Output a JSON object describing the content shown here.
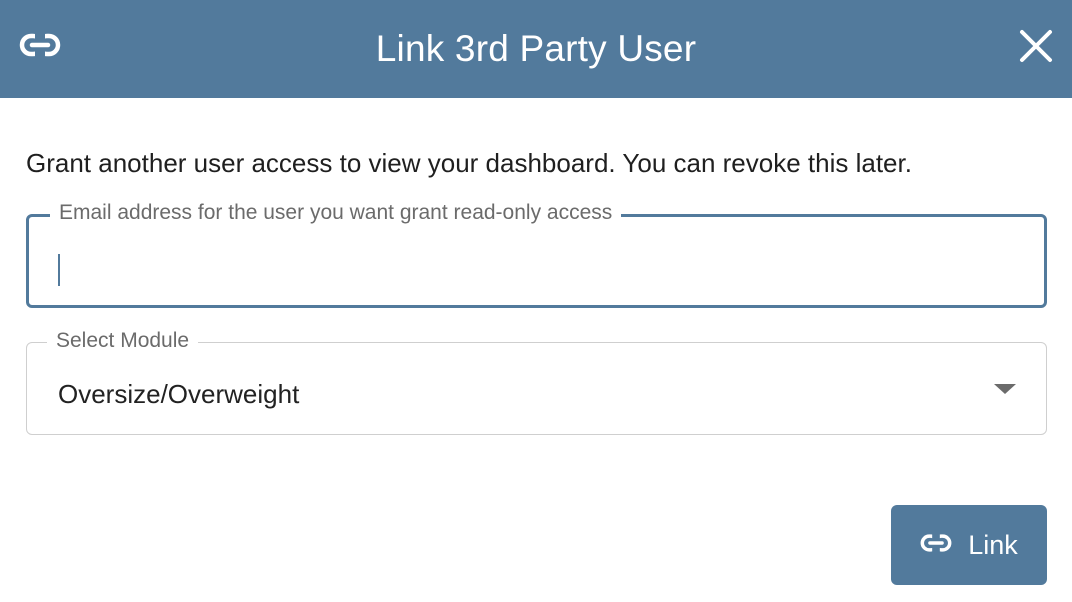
{
  "header": {
    "title": "Link 3rd Party User",
    "icon": "link-icon",
    "close_icon": "close-icon",
    "background_color": "#527a9c"
  },
  "description": "Grant another user access to view your dashboard. You can revoke this later.",
  "email_field": {
    "label": "Email address for the user you want grant read-only access",
    "value": ""
  },
  "module_select": {
    "label": "Select Module",
    "selected": "Oversize/Overweight",
    "icon": "chevron-down-icon"
  },
  "link_button": {
    "label": "Link",
    "icon": "link-icon"
  }
}
